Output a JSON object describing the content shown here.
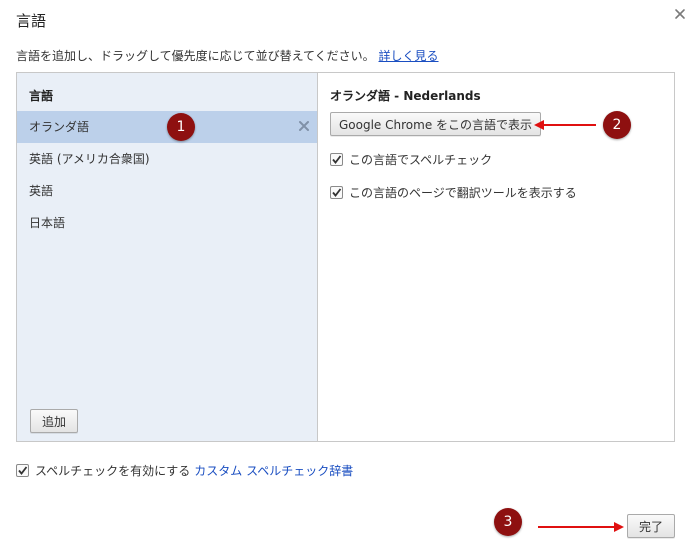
{
  "dialog": {
    "title": "言語",
    "close_icon": "close-icon"
  },
  "intro": {
    "text": "言語を追加し、ドラッグして優先度に応じて並び替えてください。",
    "link": "詳しく見る"
  },
  "languages": {
    "header": "言語",
    "items": [
      {
        "label": "オランダ語",
        "selected": true
      },
      {
        "label": "英語 (アメリカ合衆国)",
        "selected": false
      },
      {
        "label": "英語",
        "selected": false
      },
      {
        "label": "日本語",
        "selected": false
      }
    ],
    "add_button": "追加"
  },
  "detail": {
    "title": "オランダ語 - Nederlands",
    "display_button": "Google Chrome をこの言語で表示",
    "spellcheck": {
      "label": "この言語でスペルチェック",
      "checked": true
    },
    "translate": {
      "label": "この言語のページで翻訳ツールを表示する",
      "checked": true
    }
  },
  "bottom": {
    "spellcheck_label": "スペルチェックを有効にする",
    "spellcheck_checked": true,
    "custom_dict_link": "カスタム スペルチェック辞書",
    "done_button": "完了"
  },
  "annotations": {
    "badge_1": "1",
    "badge_2": "2",
    "badge_3": "3",
    "badge_color": "#8e1010",
    "arrow_color": "#e01010"
  },
  "colors": {
    "selected_row": "#bcd0ea",
    "left_pane": "#e9eff7",
    "link": "#1a4ec1"
  }
}
